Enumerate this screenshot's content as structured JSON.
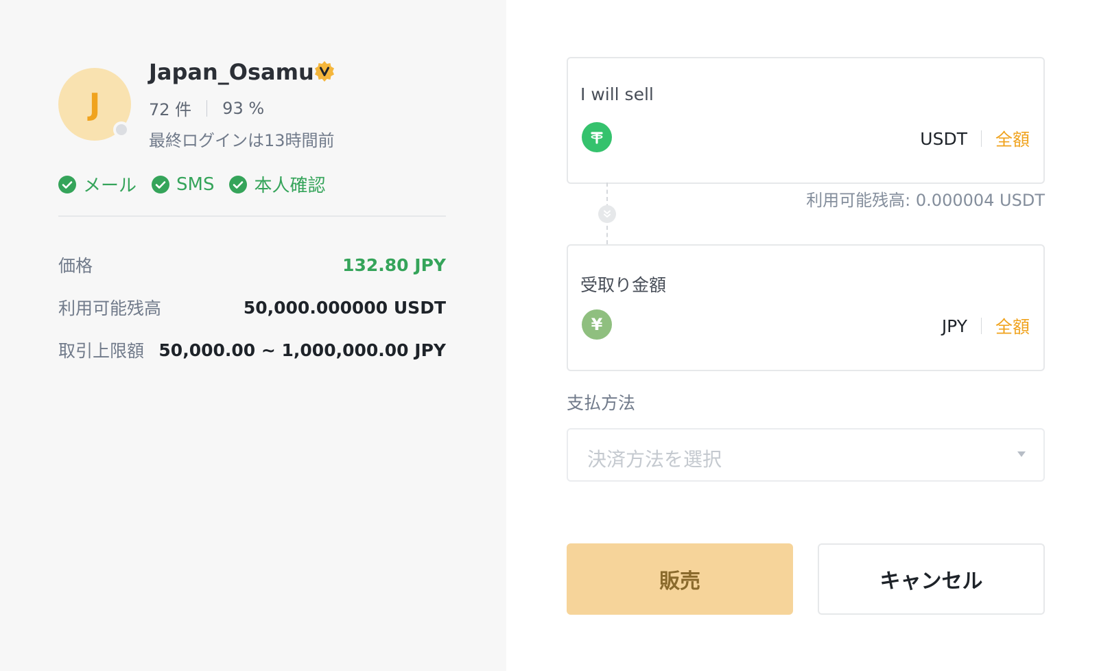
{
  "colors": {
    "accent": "#f0a31e",
    "green": "#35a45a",
    "sell_button_bg": "#f6d49a",
    "left_panel_bg": "#f7f7f7"
  },
  "merchant": {
    "avatar_letter": "J",
    "name": "Japan_Osamu",
    "badge_icon": "verified-merchant-badge-icon",
    "orders": "72 件",
    "completion": "93 %",
    "last_login": "最終ログインは13時間前",
    "verifications": [
      "メール",
      "SMS",
      "本人確認"
    ]
  },
  "details": {
    "price_label": "価格",
    "price_value": "132.80 JPY",
    "available_label": "利用可能残高",
    "available_value": "50,000.000000 USDT",
    "limit_label": "取引上限額",
    "limit_value": "50,000.00 ~ 1,000,000.00 JPY"
  },
  "sell_box": {
    "label": "I will sell",
    "coin_icon": "tether-icon",
    "currency": "USDT",
    "all_label": "全額",
    "available_balance": "利用可能残高: 0.000004 USDT"
  },
  "receive_box": {
    "label": "受取り金額",
    "coin_icon": "yen-icon",
    "currency": "JPY",
    "all_label": "全額"
  },
  "payment": {
    "label": "支払方法",
    "placeholder": "決済方法を選択"
  },
  "buttons": {
    "sell": "販売",
    "cancel": "キャンセル"
  }
}
